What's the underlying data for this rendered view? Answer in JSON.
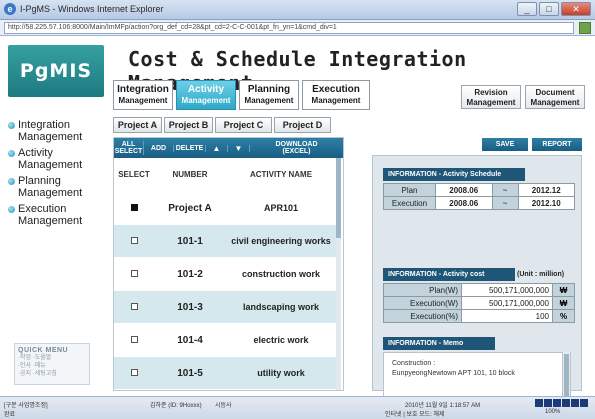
{
  "browser": {
    "window_title": "I-PgMS - Windows Internet Explorer",
    "url": "http://58.225.57.106:8000/Main/ImMFp/action?org_def_cd=28&pt_cd=2-C-C-001&pt_fn_yn=1&cmd_div=1"
  },
  "app": {
    "logo": "PgMIS",
    "title": "Cost & Schedule Integration Management"
  },
  "main_tabs": [
    {
      "line1": "Integration",
      "line2": "Management"
    },
    {
      "line1": "Activity",
      "line2": "Management"
    },
    {
      "line1": "Planning",
      "line2": "Management"
    },
    {
      "line1": "Execution",
      "line2": "Management"
    }
  ],
  "right_tabs": [
    {
      "line1": "Revision",
      "line2": "Management"
    },
    {
      "line1": "Document",
      "line2": "Management"
    }
  ],
  "sidebar": {
    "items": [
      {
        "line1": "Integration",
        "line2": "Management"
      },
      {
        "line1": "Activity",
        "line2": "Management"
      },
      {
        "line1": "Planning",
        "line2": "Management"
      },
      {
        "line1": "Execution",
        "line2": "Management"
      }
    ],
    "quick_menu": {
      "title": "QUICK MENU",
      "items": [
        "·작업  ·도움말",
        "·인사  ·메뉴",
        "·공지  ·세팅고침"
      ]
    }
  },
  "project_tabs": [
    "Project A",
    "Project B",
    "Project C",
    "Project D"
  ],
  "grid": {
    "toolbar": {
      "all_select": [
        "ALL",
        "SELECT"
      ],
      "add": "ADD",
      "delete": "DELETE",
      "up": "▲",
      "down": "▼",
      "download": [
        "DOWNLOAD",
        "(EXCEL)"
      ]
    },
    "headers": [
      "SELECT",
      "NUMBER",
      "ACTIVITY NAME"
    ],
    "rows": [
      {
        "select": "filled",
        "number": "Project A",
        "name": "APR101"
      },
      {
        "select": "empty",
        "number": "101-1",
        "name": "civil engineering works"
      },
      {
        "select": "empty",
        "number": "101-2",
        "name": "construction work"
      },
      {
        "select": "empty",
        "number": "101-3",
        "name": "landscaping work"
      },
      {
        "select": "empty",
        "number": "101-4",
        "name": "electric work"
      },
      {
        "select": "empty",
        "number": "101-5",
        "name": "utility work"
      }
    ]
  },
  "actions": {
    "save": "SAVE",
    "report": "REPORT"
  },
  "schedule": {
    "title": "INFORMATION - Activity  Schedule",
    "rows": [
      {
        "label": "Plan",
        "start": "2008.06",
        "sep": "~",
        "end": "2012.12"
      },
      {
        "label": "Execution",
        "start": "2008.06",
        "sep": "~",
        "end": "2012.10"
      }
    ]
  },
  "cost": {
    "title": "INFORMATION - Activity  cost",
    "unit": "(Unit : million)",
    "rows": [
      {
        "label": "Plan(W)",
        "value": "500,171,000,000",
        "unit": "₩"
      },
      {
        "label": "Execution(W)",
        "value": "500,171,000,000",
        "unit": "₩"
      },
      {
        "label": "Execution(%)",
        "value": "100",
        "unit": "%"
      }
    ]
  },
  "memo": {
    "title": "INFORMATION - Memo",
    "line1": "Construction :",
    "line2": "EunpyeongNewtown APT 101, 10 block"
  },
  "status": {
    "left_top": "[구분 사업명조정]",
    "left_bottom": "완료",
    "user": "김하준 (ID: 9Hoxxx)",
    "menu": "시등사",
    "datetime": "2010년 11월 9일 1:18:57 AM",
    "zone": "인터넷 | 보호 모드: 해제",
    "zoom": "100%"
  }
}
